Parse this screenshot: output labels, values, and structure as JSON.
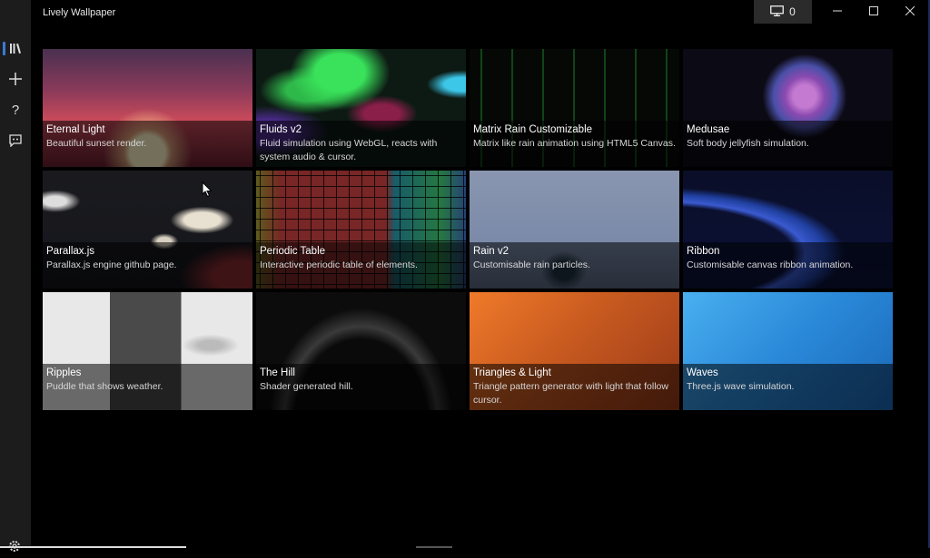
{
  "app": {
    "title": "Lively Wallpaper"
  },
  "titlebar": {
    "monitor_icon": "monitor-icon",
    "monitor_count": "0",
    "minimize_icon": "minimize-icon",
    "maximize_icon": "maximize-icon",
    "close_icon": "close-icon"
  },
  "sidebar": {
    "items": [
      {
        "name": "library",
        "icon": "library-icon",
        "active": true
      },
      {
        "name": "add",
        "icon": "plus-icon",
        "active": false
      },
      {
        "name": "help",
        "icon": "help-icon",
        "active": false
      },
      {
        "name": "feedback",
        "icon": "feedback-icon",
        "active": false
      }
    ],
    "bottom": {
      "name": "settings",
      "icon": "gear-icon"
    }
  },
  "library": {
    "wallpapers": [
      {
        "title": "Eternal Light",
        "description": "Beautiful sunset render.",
        "theme": "eternal"
      },
      {
        "title": "Fluids v2",
        "description": "Fluid simulation using WebGL, reacts with system audio & cursor.",
        "theme": "fluids"
      },
      {
        "title": "Matrix Rain Customizable",
        "description": "Matrix like rain animation using HTML5 Canvas.",
        "theme": "matrix"
      },
      {
        "title": "Medusae",
        "description": "Soft body jellyfish simulation.",
        "theme": "medusae"
      },
      {
        "title": "Parallax.js",
        "description": "Parallax.js engine github page.",
        "theme": "parallax"
      },
      {
        "title": "Periodic Table",
        "description": "Interactive periodic table of elements.",
        "theme": "periodic"
      },
      {
        "title": "Rain v2",
        "description": "Customisable rain particles.",
        "theme": "rain"
      },
      {
        "title": "Ribbon",
        "description": "Customisable canvas ribbon animation.",
        "theme": "ribbon"
      },
      {
        "title": "Ripples",
        "description": "Puddle that shows weather.",
        "theme": "ripples"
      },
      {
        "title": "The Hill",
        "description": "Shader generated hill.",
        "theme": "hill"
      },
      {
        "title": "Triangles & Light",
        "description": "Triangle pattern generator with light that follow cursor.",
        "theme": "triangles"
      },
      {
        "title": "Waves",
        "description": "Three.js wave simulation.",
        "theme": "waves"
      }
    ]
  },
  "colors": {
    "accent": "#3a7bd5",
    "sidebar_bg": "#1c1c1c",
    "background": "#000000"
  }
}
